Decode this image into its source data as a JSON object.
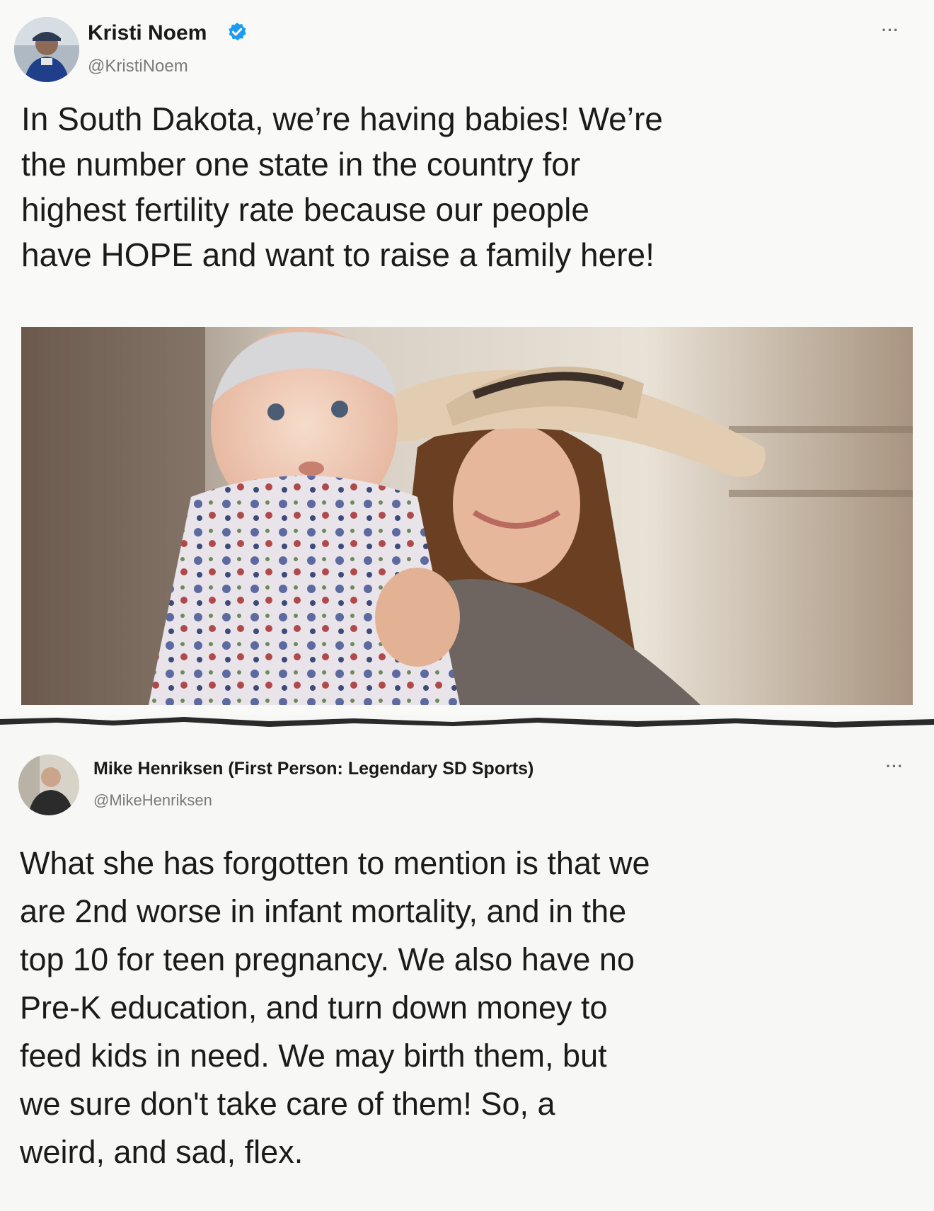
{
  "tweets": [
    {
      "author": "Kristi Noem",
      "handle": "@KristiNoem",
      "verified": true,
      "more": "···",
      "lines": [
        "In South Dakota, we’re having babies! We’re",
        "the number one state in the country for",
        "highest fertility rate because our people",
        "have HOPE and want to raise a family here!"
      ],
      "image_icon": "photo-woman-in-cowboy-hat-holding-baby"
    },
    {
      "author": "Mike Henriksen (First Person: Legendary SD Sports)",
      "handle": "@MikeHenriksen",
      "more": "···",
      "lines": [
        "What she has forgotten to mention is that we",
        "are 2nd worse in infant mortality, and in the",
        "top 10 for teen pregnancy. We also have no",
        "Pre-K education, and turn down money to",
        "feed kids in need. We may birth them, but",
        "we sure don't take care of them! So, a",
        "weird, and sad, flex."
      ]
    }
  ],
  "colors": {
    "verified_badge": "#1d9bf0",
    "handle": "#7a7a7a",
    "text": "#1b1b1b"
  }
}
